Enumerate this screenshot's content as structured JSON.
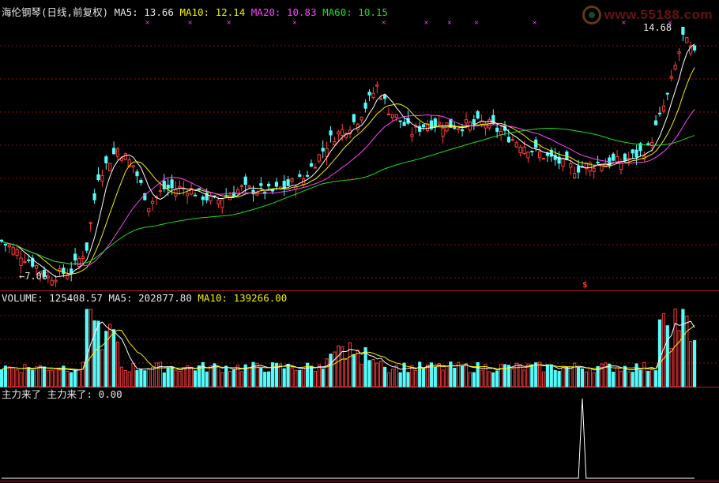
{
  "price_panel": {
    "stock_name": "海伦钢琴",
    "period_label": "(日线,前复权)",
    "ma5_label": "MA5:",
    "ma5_value": "13.66",
    "ma10_label": "MA10:",
    "ma10_value": "12.14",
    "ma20_label": "MA20:",
    "ma20_value": "10.83",
    "ma60_label": "MA60:",
    "ma60_value": "10.15",
    "high_marker": "14.68",
    "low_marker": "←7.06",
    "buy_signal": "$"
  },
  "volume_panel": {
    "volume_label": "VOLUME:",
    "volume_value": "125408.57",
    "ma5_label": "MA5:",
    "ma5_value": "202877.80",
    "ma10_label": "MA10:",
    "ma10_value": "139266.00"
  },
  "indicator_panel": {
    "label": "主力来了 主力来了:",
    "value": "0.00"
  },
  "watermark": {
    "text": "www.55188.com"
  },
  "colors": {
    "background": "#000000",
    "up_candle": "#ff3c3c",
    "down_candle": "#54fcfc",
    "ma5": "#ffffff",
    "ma10": "#f0f000",
    "ma20": "#ff44ff",
    "ma60": "#22dd22",
    "grid": "#8a1010",
    "panel_border": "#c01818"
  },
  "chart_data": {
    "type": "candlestick",
    "y_range_price": [
      6.7,
      14.9
    ],
    "price_high": 14.68,
    "price_low": 7.06,
    "latest": {
      "MA5": 13.66,
      "MA10": 12.14,
      "MA20": 10.83,
      "MA60": 10.15,
      "VOLUME": 125408.57,
      "VOL_MA5": 202877.8,
      "VOL_MA10": 139266.0,
      "主力来了": 0.0
    },
    "indicator_peak_value": 1
  }
}
